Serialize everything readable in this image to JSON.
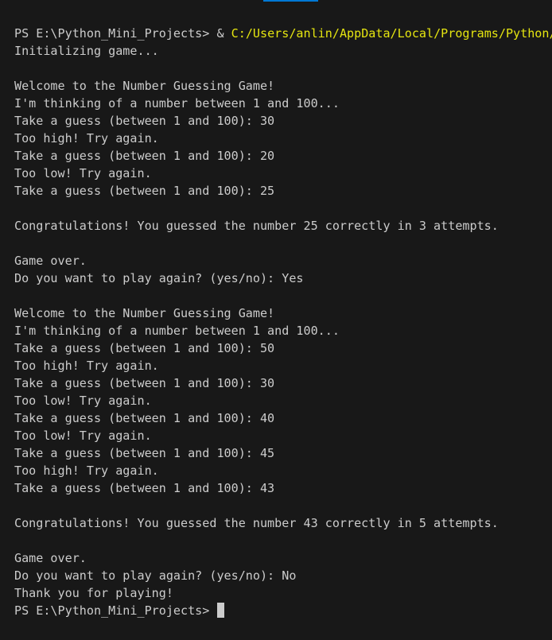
{
  "theme": {
    "background": "#181818",
    "foreground": "#cccccc",
    "path_highlight": "#e5e510",
    "accent": "#0078d4"
  },
  "terminal": {
    "command_prompt": "PS E:\\Python_Mini_Projects> ",
    "command_operator": "& ",
    "command_path": "C:/Users/anlin/AppData/Local/Programs/Python/",
    "lines": [
      "Initializing game...",
      "",
      "Welcome to the Number Guessing Game!",
      "I'm thinking of a number between 1 and 100...",
      "Take a guess (between 1 and 100): 30",
      "Too high! Try again.",
      "Take a guess (between 1 and 100): 20",
      "Too low! Try again.",
      "Take a guess (between 1 and 100): 25",
      "",
      "Congratulations! You guessed the number 25 correctly in 3 attempts.",
      "",
      "Game over.",
      "Do you want to play again? (yes/no): Yes",
      "",
      "Welcome to the Number Guessing Game!",
      "I'm thinking of a number between 1 and 100...",
      "Take a guess (between 1 and 100): 50",
      "Too high! Try again.",
      "Take a guess (between 1 and 100): 30",
      "Too low! Try again.",
      "Take a guess (between 1 and 100): 40",
      "Too low! Try again.",
      "Take a guess (between 1 and 100): 45",
      "Too high! Try again.",
      "Take a guess (between 1 and 100): 43",
      "",
      "Congratulations! You guessed the number 43 correctly in 5 attempts.",
      "",
      "Game over.",
      "Do you want to play again? (yes/no): No",
      "Thank you for playing!"
    ],
    "final_prompt": "PS E:\\Python_Mini_Projects> "
  }
}
